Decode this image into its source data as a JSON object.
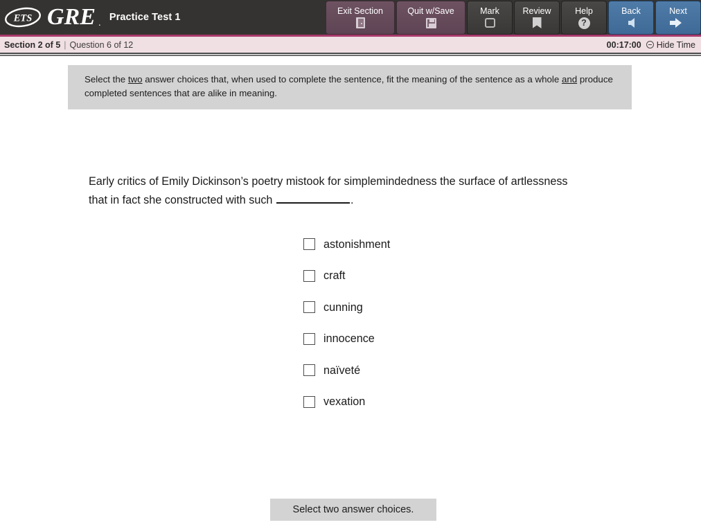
{
  "header": {
    "logo_text": "ETS",
    "brand": "GRE",
    "test_title": "Practice Test 1",
    "accent_color": "#a83a6d",
    "background_color": "#353331",
    "buttons": [
      {
        "label": "Exit Section",
        "icon": "door-exit-icon",
        "style": "maroon",
        "wide": true
      },
      {
        "label": "Quit w/Save",
        "icon": "floppy-disk-icon",
        "style": "maroon",
        "wide": true
      },
      {
        "label": "Mark",
        "icon": "empty-square-icon",
        "style": "gray",
        "wide": false
      },
      {
        "label": "Review",
        "icon": "bookmark-icon",
        "style": "gray",
        "wide": false
      },
      {
        "label": "Help",
        "icon": "question-circle-icon",
        "style": "gray",
        "wide": false
      },
      {
        "label": "Back",
        "icon": "arrow-left-icon",
        "style": "blue",
        "wide": false
      },
      {
        "label": "Next",
        "icon": "arrow-right-icon",
        "style": "blue",
        "wide": false
      }
    ]
  },
  "statusbar": {
    "section": "Section 2 of 5",
    "separator": "|",
    "question": "Question 6 of 12",
    "timer": "00:17:00",
    "hide_time_label": "Hide Time",
    "hide_time_icon": "minus-circle-icon",
    "background_color": "#f0dfe3"
  },
  "instruction": {
    "part1": "Select the ",
    "emphasis1": "two",
    "part2": " answer choices that, when used to complete the sentence, fit the meaning of the sentence as a whole ",
    "emphasis2": "and",
    "part3": " produce completed sentences that are alike in meaning."
  },
  "question": {
    "text_before_blank": "Early critics of Emily Dickinson’s poetry mistook for simplemindedness the surface of artlessness that in fact she constructed with such ",
    "blank": "__________",
    "text_after_blank": "."
  },
  "choices": [
    {
      "label": "astonishment",
      "checked": false
    },
    {
      "label": "craft",
      "checked": false
    },
    {
      "label": "cunning",
      "checked": false
    },
    {
      "label": "innocence",
      "checked": false
    },
    {
      "label": "naïveté",
      "checked": false
    },
    {
      "label": "vexation",
      "checked": false
    }
  ],
  "footer": {
    "note": "Select two answer choices."
  }
}
